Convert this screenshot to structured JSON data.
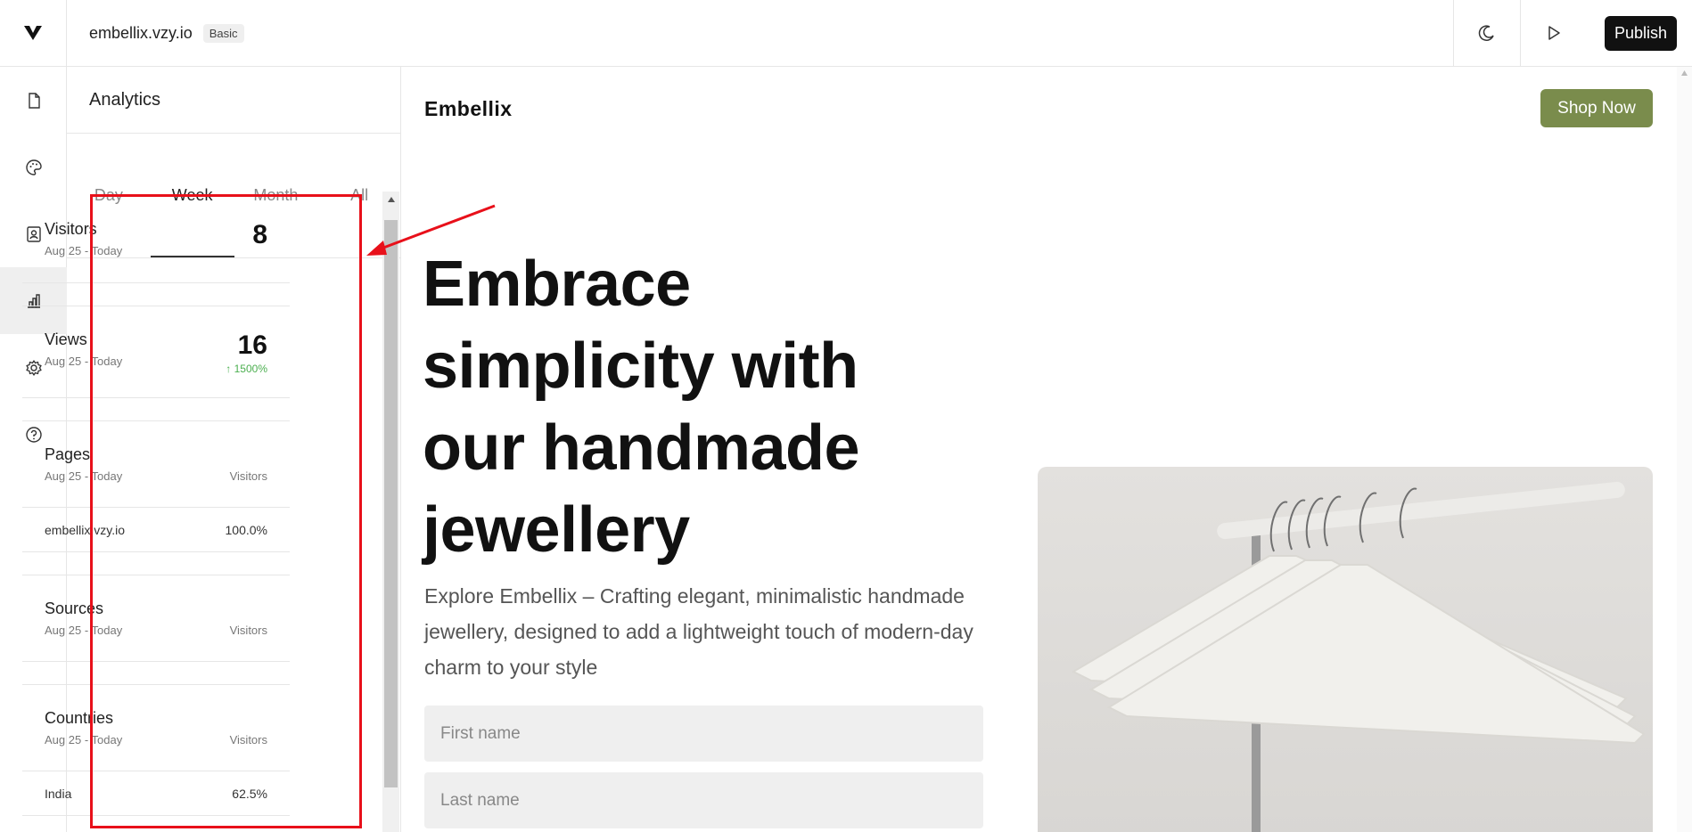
{
  "topbar": {
    "site_name": "embellix.vzy.io",
    "plan_badge": "Basic",
    "publish_label": "Publish"
  },
  "rail": {
    "items": [
      "pages-icon",
      "palette-icon",
      "contacts-icon",
      "analytics-icon",
      "settings-icon",
      "help-icon"
    ],
    "active": "analytics-icon"
  },
  "analytics": {
    "title": "Analytics",
    "tabs": [
      "Day",
      "Week",
      "Month",
      "All"
    ],
    "active_tab": "Week",
    "visitors": {
      "title": "Visitors",
      "range": "Aug 25 - Today",
      "value": "8"
    },
    "views": {
      "title": "Views",
      "range": "Aug 25 - Today",
      "value": "16",
      "delta": "1500%"
    },
    "pages": {
      "title": "Pages",
      "range": "Aug 25 - Today",
      "column": "Visitors",
      "rows": [
        {
          "label": "embellix.vzy.io",
          "value": "100.0%"
        }
      ]
    },
    "sources": {
      "title": "Sources",
      "range": "Aug 25 - Today",
      "column": "Visitors"
    },
    "countries": {
      "title": "Countries",
      "range": "Aug 25 - Today",
      "column": "Visitors",
      "rows": [
        {
          "label": "India",
          "value": "62.5%"
        }
      ]
    }
  },
  "preview": {
    "brand": "Embellix",
    "shop_button": "Shop Now",
    "headline": "Embrace simplicity with our handmade jewellery",
    "intro": "Explore Embellix – Crafting elegant, minimalistic handmade jewellery, designed to add a lightweight touch of modern-day charm to your style",
    "first_name_placeholder": "First name",
    "last_name_placeholder": "Last name"
  },
  "colors": {
    "accent_green": "#7a8c4c",
    "highlight_red": "#e8101a",
    "delta_green": "#4caf50"
  }
}
